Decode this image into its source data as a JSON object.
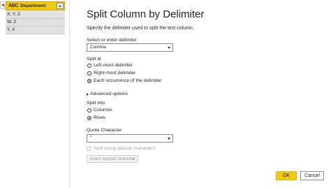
{
  "grid": {
    "column_icon": "ABC",
    "column_title": "Department",
    "rows": [
      "X, Y, Z",
      "W, Z",
      "Y, X"
    ]
  },
  "dialog": {
    "title": "Split Column by Delimiter",
    "subtitle": "Specify the delimiter used to split the text column.",
    "delimiter_label": "Select or enter delimiter",
    "delimiter_value": "Comma",
    "split_at_label": "Split at",
    "split_at_options": [
      {
        "label": "Left-most delimiter",
        "checked": false
      },
      {
        "label": "Right-most delimiter",
        "checked": false
      },
      {
        "label": "Each occurrence of the delimiter",
        "checked": true
      }
    ],
    "advanced_label": "Advanced options",
    "split_into_label": "Split into",
    "split_into_options": [
      {
        "label": "Columns",
        "checked": false
      },
      {
        "label": "Rows",
        "checked": true
      }
    ],
    "quote_label": "Quote Character",
    "quote_value": "\"",
    "special_chars_label": "Split using special characters",
    "insert_special_label": "Insert special character",
    "ok_label": "OK",
    "cancel_label": "Cancel"
  },
  "colors": {
    "accent": "#f2c811",
    "selected_row": "#e1e1e1"
  }
}
